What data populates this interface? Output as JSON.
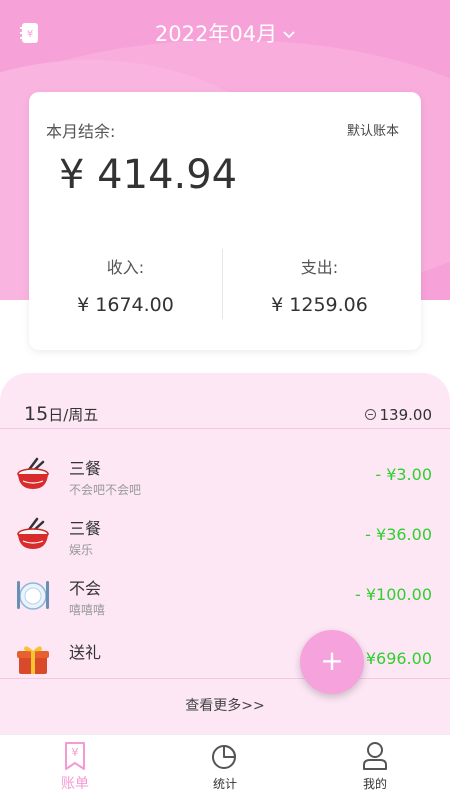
{
  "header": {
    "month": "2022年04月"
  },
  "summary": {
    "label": "本月结余:",
    "book": "默认账本",
    "balance": "¥ 414.94",
    "income_label": "收入:",
    "income_value": "¥ 1674.00",
    "expense_label": "支出:",
    "expense_value": "¥ 1259.06"
  },
  "day": {
    "date": "15",
    "weekday": "日/周五",
    "total": "139.00"
  },
  "transactions": [
    {
      "name": "三餐",
      "note": "不会吧不会吧",
      "amount": "- ¥3.00",
      "icon": "rice-bowl-icon"
    },
    {
      "name": "三餐",
      "note": "娱乐",
      "amount": "- ¥36.00",
      "icon": "rice-bowl-icon"
    },
    {
      "name": "不会",
      "note": "嘻嘻嘻",
      "amount": "- ¥100.00",
      "icon": "dining-plate-icon"
    },
    {
      "name": "送礼",
      "note": "",
      "amount": "¥696.00",
      "icon": "gift-icon"
    }
  ],
  "more_label": "查看更多>>",
  "fab_label": "+",
  "tabs": [
    {
      "label": "账单",
      "icon": "bill-icon",
      "active": true
    },
    {
      "label": "统计",
      "icon": "pie-chart-icon",
      "active": false
    },
    {
      "label": "我的",
      "icon": "profile-icon",
      "active": false
    }
  ],
  "colors": {
    "accent": "#f7a1d9",
    "income_green": "#2fcf2f",
    "panel_bg": "#fde7f5"
  }
}
